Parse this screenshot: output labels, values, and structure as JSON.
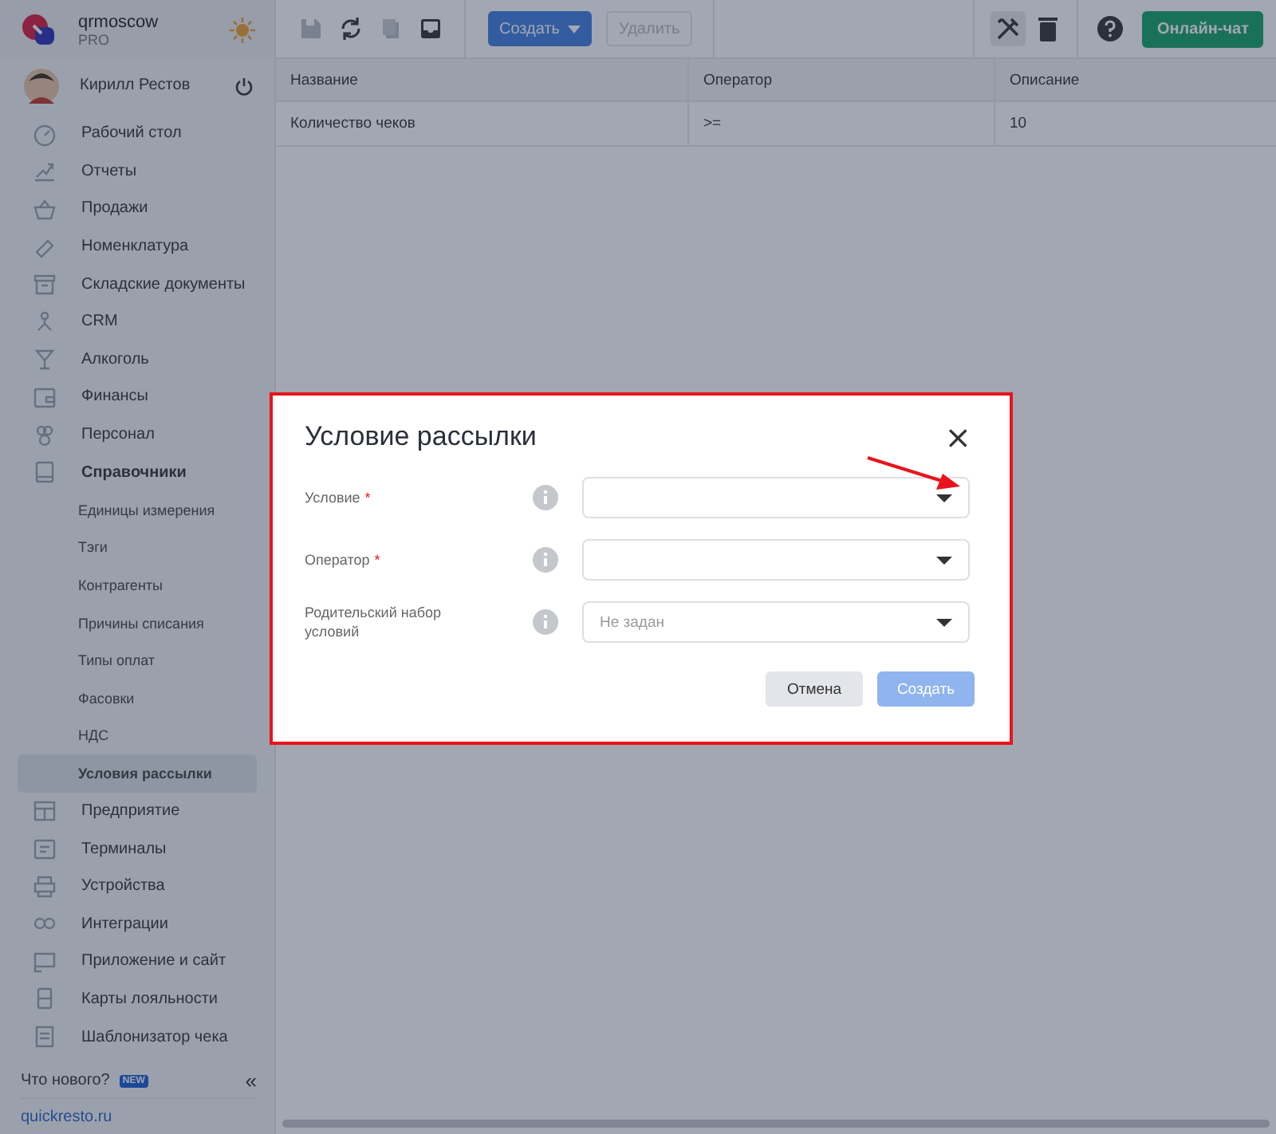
{
  "org": {
    "name": "qrmoscow",
    "plan": "PRO"
  },
  "user": {
    "name": "Кирилл Рестов"
  },
  "sidebar": {
    "items": [
      {
        "label": "Рабочий стол",
        "selected": false
      },
      {
        "label": "Отчеты",
        "selected": false
      },
      {
        "label": "Продажи",
        "selected": false
      },
      {
        "label": "Номенклатура",
        "selected": false
      },
      {
        "label": "Складские документы",
        "selected": false
      },
      {
        "label": "CRM",
        "selected": false
      },
      {
        "label": "Алкоголь",
        "selected": false
      },
      {
        "label": "Финансы",
        "selected": false
      },
      {
        "label": "Персонал",
        "selected": false
      },
      {
        "label": "Справочники",
        "selected": false,
        "expanded": true,
        "children": [
          {
            "label": "Единицы измерения",
            "selected": false
          },
          {
            "label": "Тэги",
            "selected": false
          },
          {
            "label": "Контрагенты",
            "selected": false
          },
          {
            "label": "Причины списания",
            "selected": false
          },
          {
            "label": "Типы оплат",
            "selected": false
          },
          {
            "label": "Фасовки",
            "selected": false
          },
          {
            "label": "НДС",
            "selected": false
          },
          {
            "label": "Условия рассылки",
            "selected": true
          }
        ]
      },
      {
        "label": "Предприятие",
        "selected": false
      },
      {
        "label": "Терминалы",
        "selected": false
      },
      {
        "label": "Устройства",
        "selected": false
      },
      {
        "label": "Интеграции",
        "selected": false
      },
      {
        "label": "Приложение и сайт",
        "selected": false
      },
      {
        "label": "Карты лояльности",
        "selected": false
      },
      {
        "label": "Шаблонизатор чека",
        "selected": false
      }
    ],
    "whats_new": "Что нового?",
    "new_badge": "NEW",
    "collapse": "«",
    "site_link": "quickresto.ru"
  },
  "toolbar": {
    "create": "Создать",
    "delete": {
      "label": "Удалить",
      "disabled": true
    },
    "chat": "Онлайн-чат"
  },
  "table": {
    "columns": [
      "Название",
      "Оператор",
      "Описание"
    ],
    "rows": [
      [
        "Количество чеков",
        ">=",
        "10"
      ]
    ]
  },
  "dialog": {
    "title": "Условие рассылки",
    "highlighted": true,
    "fields": [
      {
        "label": "Условие",
        "required_mark": "*",
        "pointed": true
      },
      {
        "label": "Оператор",
        "required_mark": "*",
        "pointed": false
      },
      {
        "label": "Родительский набор условий",
        "pointed": false,
        "placeholder": "Не задан"
      }
    ],
    "close": "×",
    "cancel": "Отмена",
    "submit": {
      "label": "Создать",
      "disabled": true
    }
  }
}
